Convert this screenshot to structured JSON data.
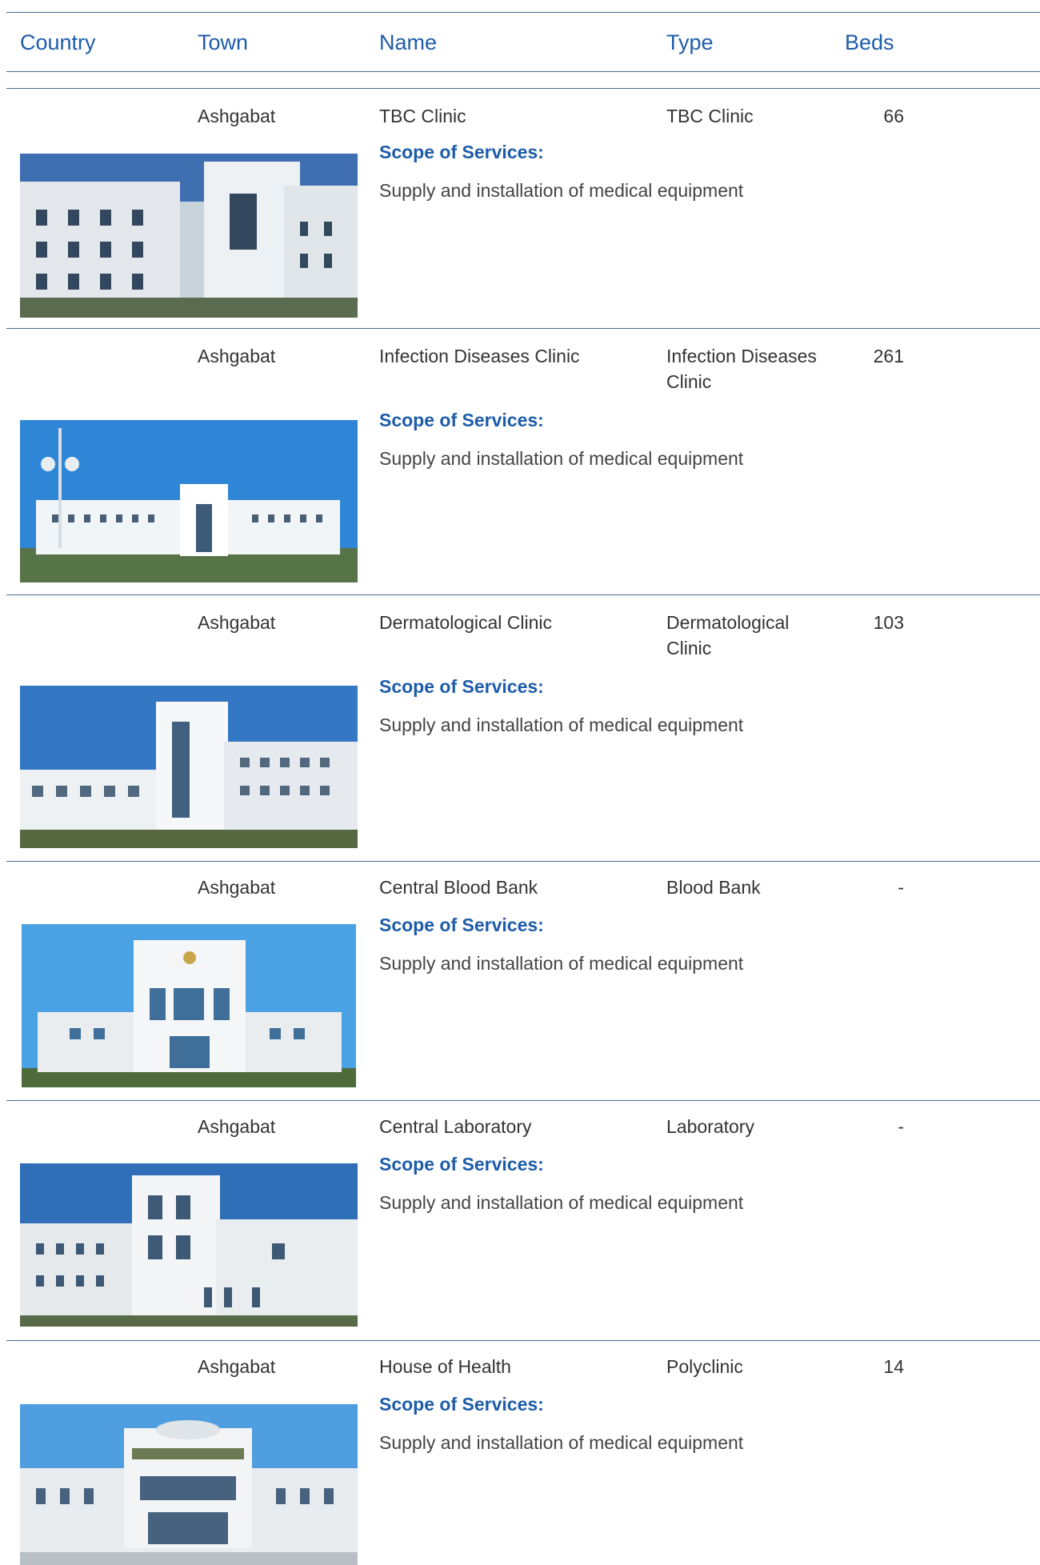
{
  "table": {
    "columns": {
      "country": "Country",
      "town": "Town",
      "name": "Name",
      "type": "Type",
      "beds": "Beds"
    },
    "scope_label": "Scope of Services:",
    "rows": [
      {
        "country": "",
        "town": "Ashgabat",
        "name": "TBC Clinic",
        "type": "TBC Clinic",
        "beds": "66",
        "scope": "Supply and installation of medical equipment",
        "photo_icon": "building-photo"
      },
      {
        "country": "",
        "town": "Ashgabat",
        "name": "Infection Diseases Clinic",
        "type": "Infection Diseases Clinic",
        "beds": "261",
        "scope": "Supply and installation of medical equipment",
        "photo_icon": "building-photo"
      },
      {
        "country": "",
        "town": "Ashgabat",
        "name": "Dermatological Clinic",
        "type": "Dermatological Clinic",
        "beds": "103",
        "scope": "Supply and installation of medical equipment",
        "photo_icon": "building-photo"
      },
      {
        "country": "",
        "town": "Ashgabat",
        "name": "Central Blood Bank",
        "type": "Blood Bank",
        "beds": "-",
        "scope": "Supply and installation of medical equipment",
        "photo_icon": "building-photo"
      },
      {
        "country": "",
        "town": "Ashgabat",
        "name": "Central Laboratory",
        "type": "Laboratory",
        "beds": "-",
        "scope": "Supply and installation of medical equipment",
        "photo_icon": "building-photo"
      },
      {
        "country": "",
        "town": "Ashgabat",
        "name": "House of Health",
        "type": "Polyclinic",
        "beds": "14",
        "scope": "Supply and installation of medical equipment",
        "photo_icon": "building-photo"
      }
    ]
  },
  "colors": {
    "accent": "#1d5ca8",
    "rule": "#4a6f97",
    "text": "#333333"
  }
}
